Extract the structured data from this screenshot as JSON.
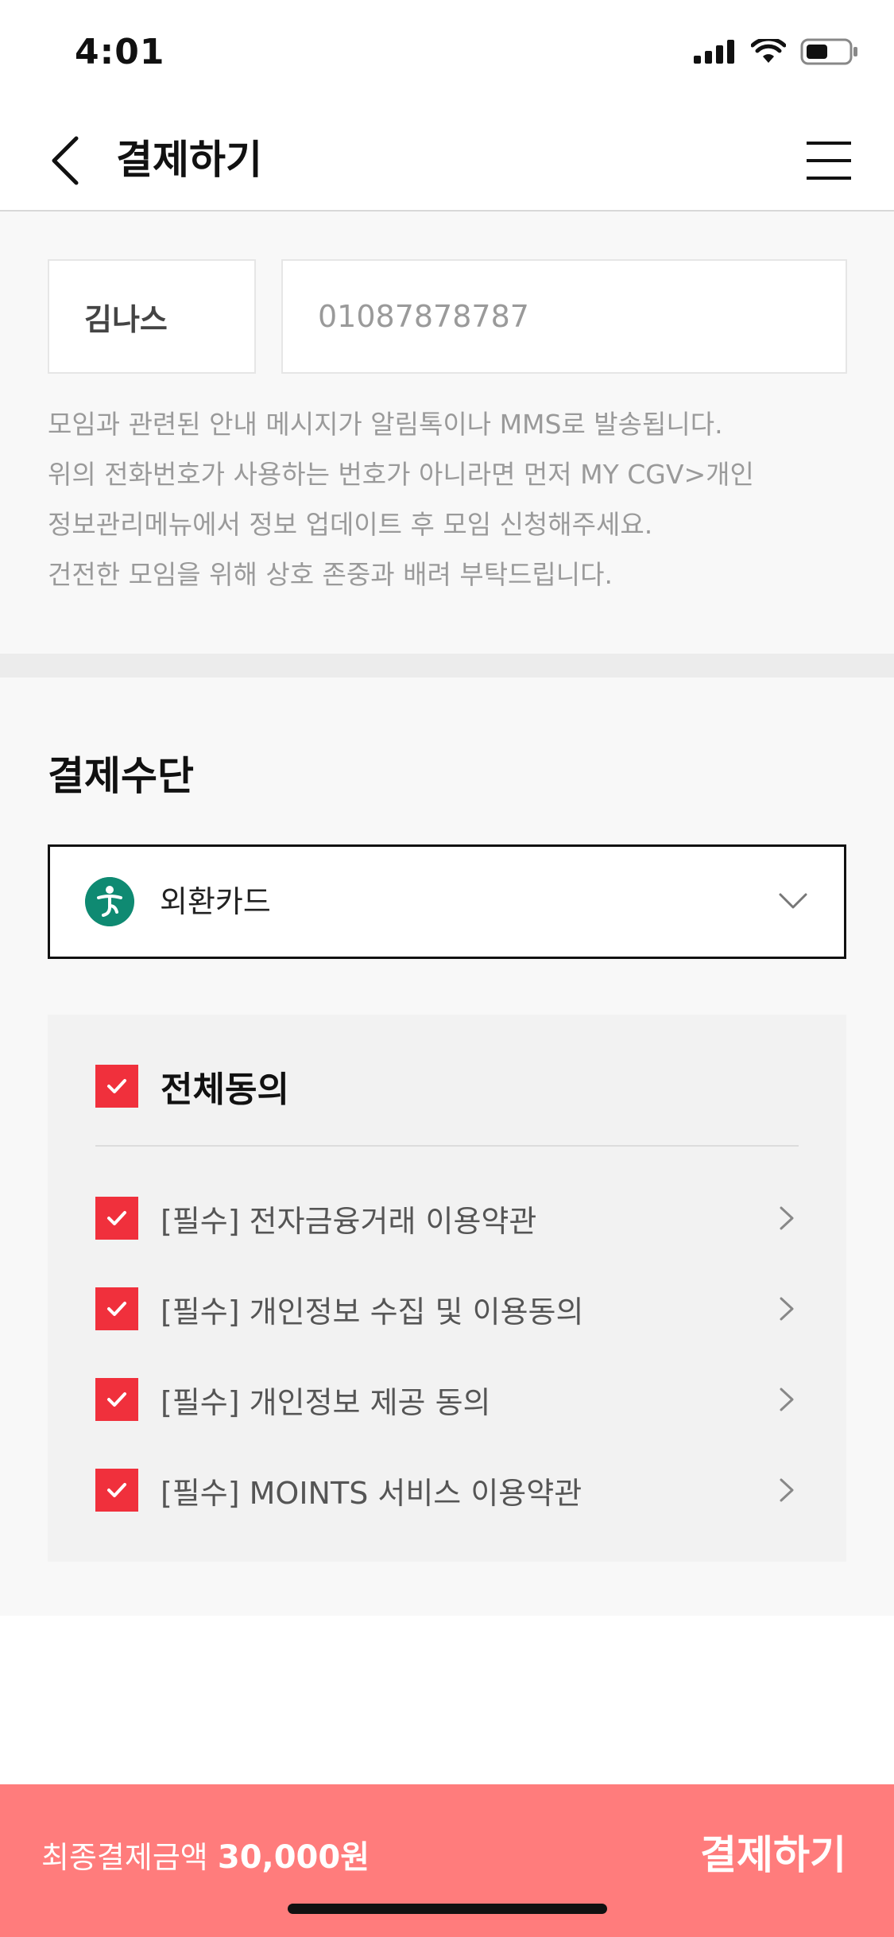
{
  "status_bar": {
    "time": "4:01"
  },
  "nav": {
    "title": "결제하기"
  },
  "contact": {
    "name": "김나스",
    "phone": "01087878787",
    "notice_lines": [
      "모임과 관련된 안내 메시지가 알림톡이나 MMS로 발송됩니다.",
      "위의 전화번호가 사용하는 번호가 아니라면 먼저 MY CGV>개인",
      "정보관리메뉴에서 정보 업데이트 후 모임 신청해주세요.",
      "건전한 모임을 위해 상호 존중과 배려 부탁드립니다."
    ]
  },
  "payment": {
    "heading": "결제수단",
    "selected_card": "외환카드",
    "card_logo_color": "#0f8a72"
  },
  "agreements": {
    "all_label": "전체동의",
    "items": [
      {
        "label": "[필수] 전자금융거래 이용약관",
        "checked": true
      },
      {
        "label": "[필수] 개인정보 수집 및 이용동의",
        "checked": true
      },
      {
        "label": "[필수] 개인정보 제공 동의",
        "checked": true
      },
      {
        "label": "[필수] MOINTS 서비스 이용약관",
        "checked": true
      }
    ]
  },
  "pay_bar": {
    "total_label": "최종결제금액",
    "total_amount": "30,000원",
    "button_label": "결제하기"
  },
  "colors": {
    "accent_red": "#f0303c",
    "pay_bar": "#ff7c7c"
  }
}
